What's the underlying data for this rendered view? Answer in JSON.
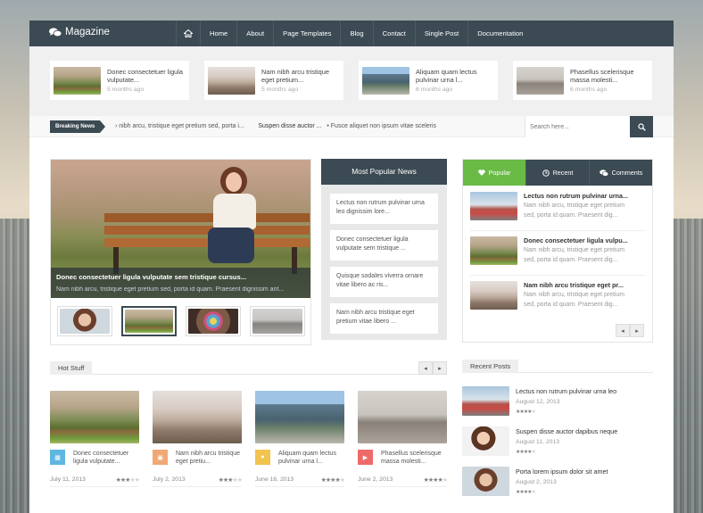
{
  "brand": {
    "name": "Magazine"
  },
  "menu": [
    "Home",
    "About",
    "Page Templates",
    "Blog",
    "Contact",
    "Single Post",
    "Documentation"
  ],
  "featured": [
    {
      "title": "Donec consectetuer ligula vulputate...",
      "date": "5 months ago",
      "img": "park"
    },
    {
      "title": "Nam nibh arcu tristique eget pretium...",
      "date": "5 months ago",
      "img": "pier"
    },
    {
      "title": "Aliquam quam lectus pulvinar urna l...",
      "date": "6 months ago",
      "img": "bldg"
    },
    {
      "title": "Phasellus scelerisque massa molesti...",
      "date": "6 months ago",
      "img": "dogs"
    }
  ],
  "ticker": {
    "label": "Breaking News",
    "text1": "› nibh arcu, tristique eget pretium sed, porta i...",
    "bold": "Suspen disse auctor ...",
    "text2": "• Fusce aliquet non ipsum vitae sceleris"
  },
  "search": {
    "placeholder": "Search here..."
  },
  "slider": {
    "title": "Donec consectetuer ligula vulputate sem tristique cursus...",
    "excerpt": "Nam nibh arcu, tristique eget pretium sed, porta id quam. Praesent dignissim ant..."
  },
  "popular": {
    "heading": "Most Popular News",
    "items": [
      "Lectus non rutrum pulvinar urna leo dignissim lore...",
      "Donec consectetuer ligula vulputate sem tristique ...",
      "Quisque sodales viverra ornare vitae libero ac ris...",
      "Nam nibh arcu tristique eget pretium vitae libero ..."
    ]
  },
  "tabs": {
    "labels": [
      "Popular",
      "Recent",
      "Comments"
    ],
    "items": [
      {
        "title": "Lectus non rutrum pulvinar urna...",
        "text": "Nam nibh arcu, tristique eget pretium sed, porta id quam. Praesent dig...",
        "img": "lon"
      },
      {
        "title": "Donec consectetuer ligula vulpu...",
        "text": "Nam nibh arcu, tristique eget pretium sed, porta id quam. Praesent dig...",
        "img": "park"
      },
      {
        "title": "Nam nibh arcu tristique eget pr...",
        "text": "Nam nibh arcu, tristique eget pretium sed, porta id quam. Praesent dig...",
        "img": "pier"
      }
    ]
  },
  "hot": {
    "heading": "Hot Stuff",
    "items": [
      {
        "title": "Donec consectetuer ligula vulputate...",
        "date": "July 11, 2013",
        "rating": 3,
        "img": "park",
        "color": "#5fb6e0"
      },
      {
        "title": "Nam nibh arcu tristique eget pretiu...",
        "date": "July 2, 2013",
        "rating": 3,
        "img": "pier",
        "color": "#f0a874"
      },
      {
        "title": "Aliquam quam lectus pulvinar urna l...",
        "date": "June 16, 2013",
        "rating": 4,
        "img": "bldg",
        "color": "#f2c34e"
      },
      {
        "title": "Phasellus scelerisque massa molesti...",
        "date": "June 2, 2013",
        "rating": 4,
        "img": "dogs",
        "color": "#ee6a6a"
      }
    ]
  },
  "recent": {
    "heading": "Recent Posts",
    "items": [
      {
        "title": "Lectus non rutrum pulvinar urna leo",
        "date": "August 12, 2013",
        "rating": 4,
        "img": "lon"
      },
      {
        "title": "Suspen disse auctor dapibus neque",
        "date": "August 11, 2013",
        "rating": 4,
        "img": "woman"
      },
      {
        "title": "Porta lorem ipsum dolor sit amet",
        "date": "August 2, 2013",
        "rating": 4,
        "img": "girl"
      }
    ]
  },
  "colors": {
    "dark": "#3b4a53",
    "green": "#6aba46"
  }
}
